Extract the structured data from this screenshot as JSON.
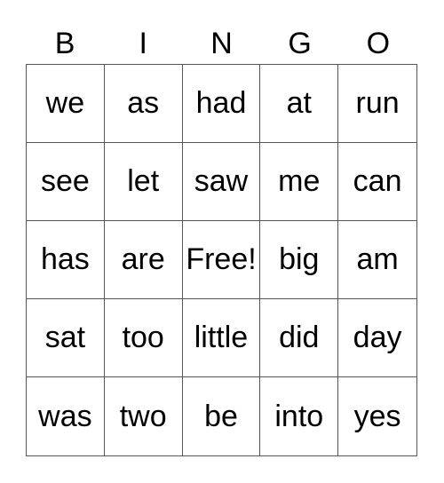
{
  "header": [
    "B",
    "I",
    "N",
    "G",
    "O"
  ],
  "rows": [
    [
      "we",
      "as",
      "had",
      "at",
      "run"
    ],
    [
      "see",
      "let",
      "saw",
      "me",
      "can"
    ],
    [
      "has",
      "are",
      "Free!",
      "big",
      "am"
    ],
    [
      "sat",
      "too",
      "little",
      "did",
      "day"
    ],
    [
      "was",
      "two",
      "be",
      "into",
      "yes"
    ]
  ]
}
